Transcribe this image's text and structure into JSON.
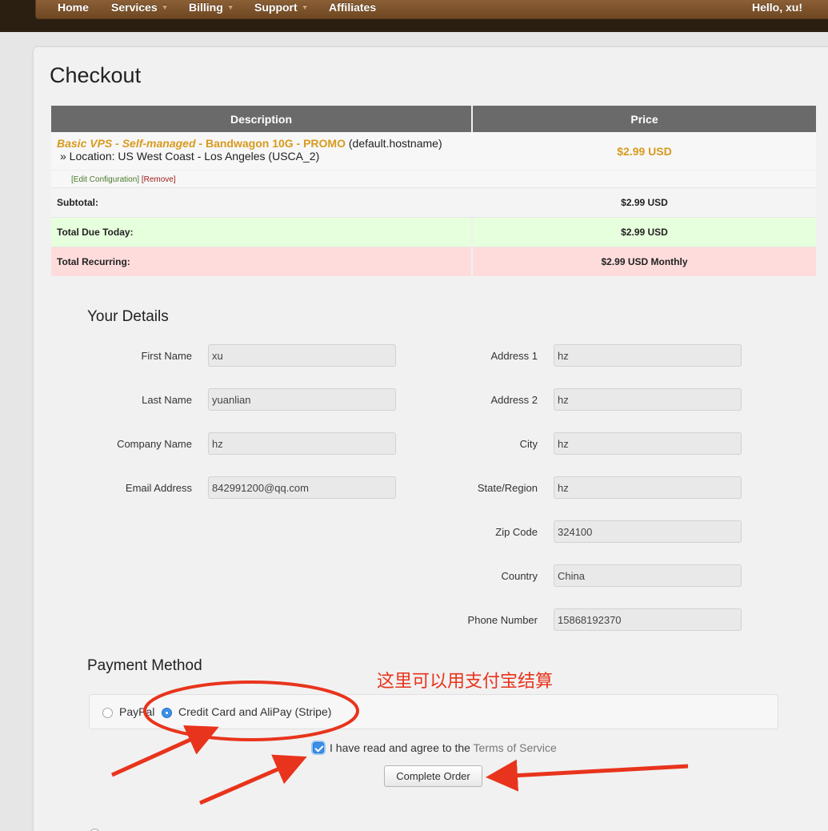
{
  "nav": {
    "home": "Home",
    "services": "Services",
    "billing": "Billing",
    "support": "Support",
    "affiliates": "Affiliates",
    "greeting": "Hello, xu!"
  },
  "page": {
    "title": "Checkout"
  },
  "cart": {
    "col_description": "Description",
    "col_price": "Price",
    "product_name": "Basic VPS - Self-managed",
    "product_group": "Bandwagon 10G - PROMO",
    "hostname": "(default.hostname)",
    "location": "» Location: US West Coast - Los Angeles (USCA_2)",
    "product_price": "$2.99 USD",
    "edit_link": "[Edit Configuration]",
    "remove_link": "[Remove]",
    "subtotal_label": "Subtotal:",
    "subtotal_value": "$2.99 USD",
    "due_today_label": "Total Due Today:",
    "due_today_value": "$2.99 USD",
    "recurring_label": "Total Recurring:",
    "recurring_value": "$2.99 USD Monthly"
  },
  "details": {
    "title": "Your Details",
    "first_name_label": "First Name",
    "first_name": "xu",
    "last_name_label": "Last Name",
    "last_name": "yuanlian",
    "company_label": "Company Name",
    "company": "hz",
    "email_label": "Email Address",
    "email": "842991200@qq.com",
    "address1_label": "Address 1",
    "address1": "hz",
    "address2_label": "Address 2",
    "address2": "hz",
    "city_label": "City",
    "city": "hz",
    "state_label": "State/Region",
    "state": "hz",
    "zip_label": "Zip Code",
    "zip": "324100",
    "country_label": "Country",
    "country": "China",
    "phone_label": "Phone Number",
    "phone": "15868192370"
  },
  "payment": {
    "title": "Payment Method",
    "paypal_label": "PayPal",
    "stripe_label": "Credit Card and AliPay (Stripe)",
    "selected": "stripe"
  },
  "tos": {
    "text": "I have read and agree to the ",
    "link": "Terms of Service",
    "checked": true
  },
  "submit": {
    "label": "Complete Order"
  },
  "annotation": {
    "text": "这里可以用支付宝结算",
    "color": "#e8341c"
  }
}
